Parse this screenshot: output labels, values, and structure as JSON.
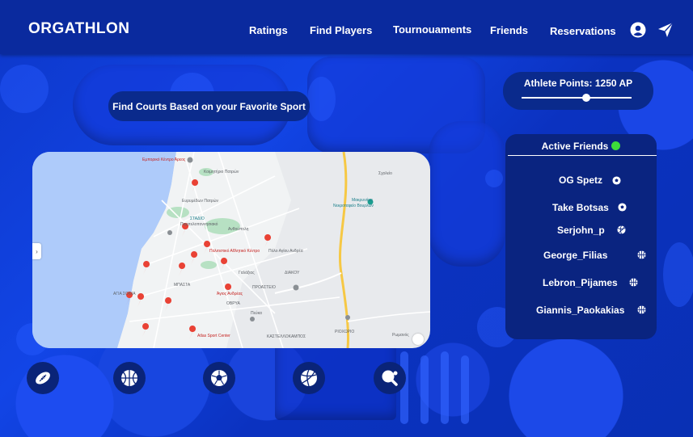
{
  "header": {
    "logo": "ORGATHLON",
    "nav": [
      "Ratings",
      "Find Players",
      "Tournouaments",
      "Friends",
      "Reservations"
    ],
    "icons": [
      "user-icon",
      "send-icon"
    ]
  },
  "find_courts": {
    "label": "Find Courts Based on your Favorite Sport"
  },
  "athlete_points": {
    "label": "Athlete Points: 1250 AP",
    "level": 0.59
  },
  "map": {
    "labels": [
      "Εμπορικό Κέντρο Άρεος",
      "Κοιμητήριο Πατρών",
      "Σχολείο",
      "Μακρυνάκη",
      "Νεκροταφείο Βουρλών",
      "Ευρυμέδων Πατρών",
      "ΣΤΑΔΙΟ",
      "Παμπελοποννησιακό",
      "Ανθούπολη",
      "Πολιτιστικό Αθλητικό Κέντρο",
      "Πόλο Αγίου Ανδρέα",
      "Γαλάξιας",
      "ΔΙΑΚΟΥ",
      "ΜΠΑΣΤΑ",
      "ΠΡΟΑΣΤΕΙΟ",
      "ΟΒΡΥΑ",
      "Πεύκα",
      "ΑΓΙΑ ΣΟΦΙΑ",
      "Άγιος Ανδρέας",
      "Atlas Sport Center",
      "ΚΑΣΤΕΛΛΟΚΑΜΠΟΣ",
      "ΡΙΟΧΩΡΙΟ",
      "Ρωμανός"
    ]
  },
  "friends": {
    "title": "Active Friends",
    "status_color": "#3ddc3a",
    "list": [
      {
        "name": "OG Spetz",
        "sport": "soccer-ball-icon"
      },
      {
        "name": "Take Botsas",
        "sport": "soccer-ball-icon"
      },
      {
        "name": "Serjohn_p",
        "sport": "volleyball-icon"
      },
      {
        "name": "George_Filias",
        "sport": "basketball-icon"
      },
      {
        "name": "Lebron_Pijames",
        "sport": "basketball-icon"
      },
      {
        "name": "Giannis_Paokakias",
        "sport": "basketball-icon"
      }
    ]
  },
  "sports": [
    "football-icon",
    "basketball-icon",
    "soccer-ball-icon",
    "volleyball-icon",
    "ping-pong-icon"
  ],
  "colors": {
    "header": "#0a2a9e",
    "panel": "#0a2480",
    "accent": "#3ddc3a"
  }
}
